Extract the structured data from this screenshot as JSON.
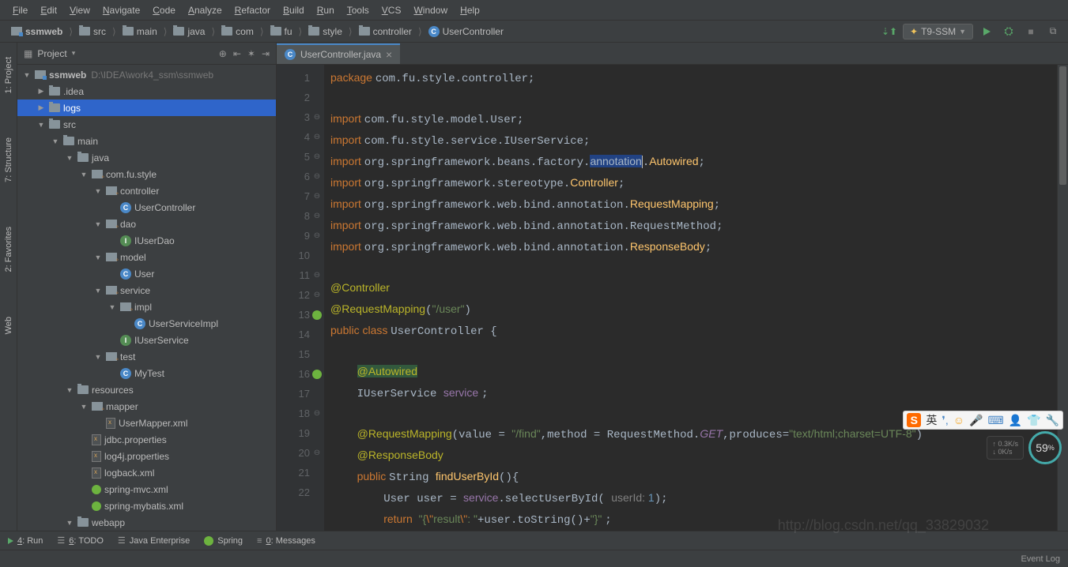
{
  "menu": [
    "File",
    "Edit",
    "View",
    "Navigate",
    "Code",
    "Analyze",
    "Refactor",
    "Build",
    "Run",
    "Tools",
    "VCS",
    "Window",
    "Help"
  ],
  "breadcrumb": [
    {
      "icon": "module",
      "label": "ssmweb"
    },
    {
      "icon": "folder",
      "label": "src"
    },
    {
      "icon": "folder",
      "label": "main"
    },
    {
      "icon": "folder",
      "label": "java"
    },
    {
      "icon": "folder",
      "label": "com"
    },
    {
      "icon": "folder",
      "label": "fu"
    },
    {
      "icon": "folder",
      "label": "style"
    },
    {
      "icon": "folder",
      "label": "controller"
    },
    {
      "icon": "class",
      "label": "UserController"
    }
  ],
  "runConfig": "T9-SSM",
  "panel": {
    "title": "Project"
  },
  "tree": [
    {
      "depth": 0,
      "arrow": "open",
      "icon": "module",
      "label": "ssmweb",
      "path": "D:\\IDEA\\work4_ssm\\ssmweb",
      "bold": true
    },
    {
      "depth": 1,
      "arrow": "closed",
      "icon": "folder",
      "label": ".idea"
    },
    {
      "depth": 1,
      "arrow": "closed",
      "icon": "folder",
      "label": "logs",
      "selected": true
    },
    {
      "depth": 1,
      "arrow": "open",
      "icon": "folder",
      "label": "src"
    },
    {
      "depth": 2,
      "arrow": "open",
      "icon": "folder",
      "label": "main"
    },
    {
      "depth": 3,
      "arrow": "open",
      "icon": "folder",
      "label": "java"
    },
    {
      "depth": 4,
      "arrow": "open",
      "icon": "pkg",
      "label": "com.fu.style"
    },
    {
      "depth": 5,
      "arrow": "open",
      "icon": "pkg",
      "label": "controller"
    },
    {
      "depth": 6,
      "arrow": "",
      "icon": "class",
      "label": "UserController"
    },
    {
      "depth": 5,
      "arrow": "open",
      "icon": "pkg",
      "label": "dao"
    },
    {
      "depth": 6,
      "arrow": "",
      "icon": "interface",
      "label": "IUserDao"
    },
    {
      "depth": 5,
      "arrow": "open",
      "icon": "pkg",
      "label": "model"
    },
    {
      "depth": 6,
      "arrow": "",
      "icon": "class",
      "label": "User"
    },
    {
      "depth": 5,
      "arrow": "open",
      "icon": "pkg",
      "label": "service"
    },
    {
      "depth": 6,
      "arrow": "open",
      "icon": "pkg",
      "label": "impl"
    },
    {
      "depth": 7,
      "arrow": "",
      "icon": "class",
      "label": "UserServiceImpl"
    },
    {
      "depth": 6,
      "arrow": "",
      "icon": "interface",
      "label": "IUserService"
    },
    {
      "depth": 5,
      "arrow": "open",
      "icon": "pkg",
      "label": "test"
    },
    {
      "depth": 6,
      "arrow": "",
      "icon": "class",
      "label": "MyTest"
    },
    {
      "depth": 3,
      "arrow": "open",
      "icon": "folder",
      "label": "resources"
    },
    {
      "depth": 4,
      "arrow": "open",
      "icon": "pkg",
      "label": "mapper"
    },
    {
      "depth": 5,
      "arrow": "",
      "icon": "xml",
      "label": "UserMapper.xml"
    },
    {
      "depth": 4,
      "arrow": "",
      "icon": "xml",
      "label": "jdbc.properties"
    },
    {
      "depth": 4,
      "arrow": "",
      "icon": "xml",
      "label": "log4j.properties"
    },
    {
      "depth": 4,
      "arrow": "",
      "icon": "xml",
      "label": "logback.xml"
    },
    {
      "depth": 4,
      "arrow": "",
      "icon": "spring",
      "label": "spring-mvc.xml"
    },
    {
      "depth": 4,
      "arrow": "",
      "icon": "spring",
      "label": "spring-mybatis.xml"
    },
    {
      "depth": 3,
      "arrow": "open",
      "icon": "folder",
      "label": "webapp"
    }
  ],
  "tab": {
    "title": "UserController.java"
  },
  "code": {
    "lines": [
      1,
      2,
      3,
      4,
      5,
      6,
      7,
      8,
      9,
      10,
      11,
      12,
      13,
      14,
      15,
      16,
      17,
      18,
      19,
      20,
      21,
      22
    ],
    "l1a": "package ",
    "l1b": "com.fu.style.controller;",
    "l3a": "import ",
    "l3b": "com.fu.style.model.User;",
    "l4a": "import ",
    "l4b": "com.fu.style.service.IUserService;",
    "l5a": "import ",
    "l5b": "org.springframework.beans.factory.",
    "l5c": "annotation",
    "l5d": ".",
    "l5e": "Autowired",
    "l5f": ";",
    "l6a": "import ",
    "l6b": "org.springframework.stereotype.",
    "l6c": "Controller",
    "l6d": ";",
    "l7a": "import ",
    "l7b": "org.springframework.web.bind.annotation.",
    "l7c": "RequestMapping",
    "l7d": ";",
    "l8a": "import ",
    "l8b": "org.springframework.web.bind.annotation.RequestMethod;",
    "l9a": "import ",
    "l9b": "org.springframework.web.bind.annotation.",
    "l9c": "ResponseBody",
    "l9d": ";",
    "l11": "@Controller",
    "l12a": "@RequestMapping",
    "l12b": "(",
    "l12c": "\"/user\"",
    "l12d": ")",
    "l13a": "public class ",
    "l13b": "UserController ",
    "l13c": "{",
    "l15": "@Autowired",
    "l16a": "IUserService ",
    "l16b": "service ",
    "l16c": ";",
    "l18a": "@RequestMapping",
    "l18b": "(value = ",
    "l18c": "\"/find\"",
    "l18d": ",method = RequestMethod.",
    "l18e": "GET",
    "l18f": ",produces=",
    "l18g": "\"text/html;charset=UTF-8\"",
    "l18h": ")",
    "l19": "@ResponseBody",
    "l20a": "public ",
    "l20b": "String ",
    "l20c": "findUserById",
    "l20d": "(){",
    "l21a": "User user = ",
    "l21b": "service",
    "l21c": ".selectUserById( ",
    "l21d": "userId: ",
    "l21e": "1",
    "l21f": ");",
    "l22a": "return  ",
    "l22b": "\"{",
    "l22c": "\\\"",
    "l22d": "result",
    "l22e": "\\\"",
    "l22f": ": \"",
    "l22g": "+user.toString()+",
    "l22h": "\"}\" ",
    "l22i": ";"
  },
  "bottom": [
    {
      "icon": "play",
      "label": "4: Run",
      "underline": "4"
    },
    {
      "icon": "todo",
      "label": "6: TODO",
      "underline": "6"
    },
    {
      "icon": "java",
      "label": "Java Enterprise"
    },
    {
      "icon": "spring",
      "label": "Spring"
    },
    {
      "icon": "msg",
      "label": "0: Messages",
      "underline": "0"
    }
  ],
  "status": {
    "eventlog": "Event Log"
  },
  "speed": {
    "up": "0.3K/s",
    "down": "0K/s",
    "pct": "59",
    "unit": "%"
  },
  "gutterLeft": [
    "1: Project",
    "7: Structure",
    "2: Favorites",
    "Web"
  ],
  "ime": {
    "lang": "英"
  },
  "watermark": "http://blog.csdn.net/qq_33829032"
}
